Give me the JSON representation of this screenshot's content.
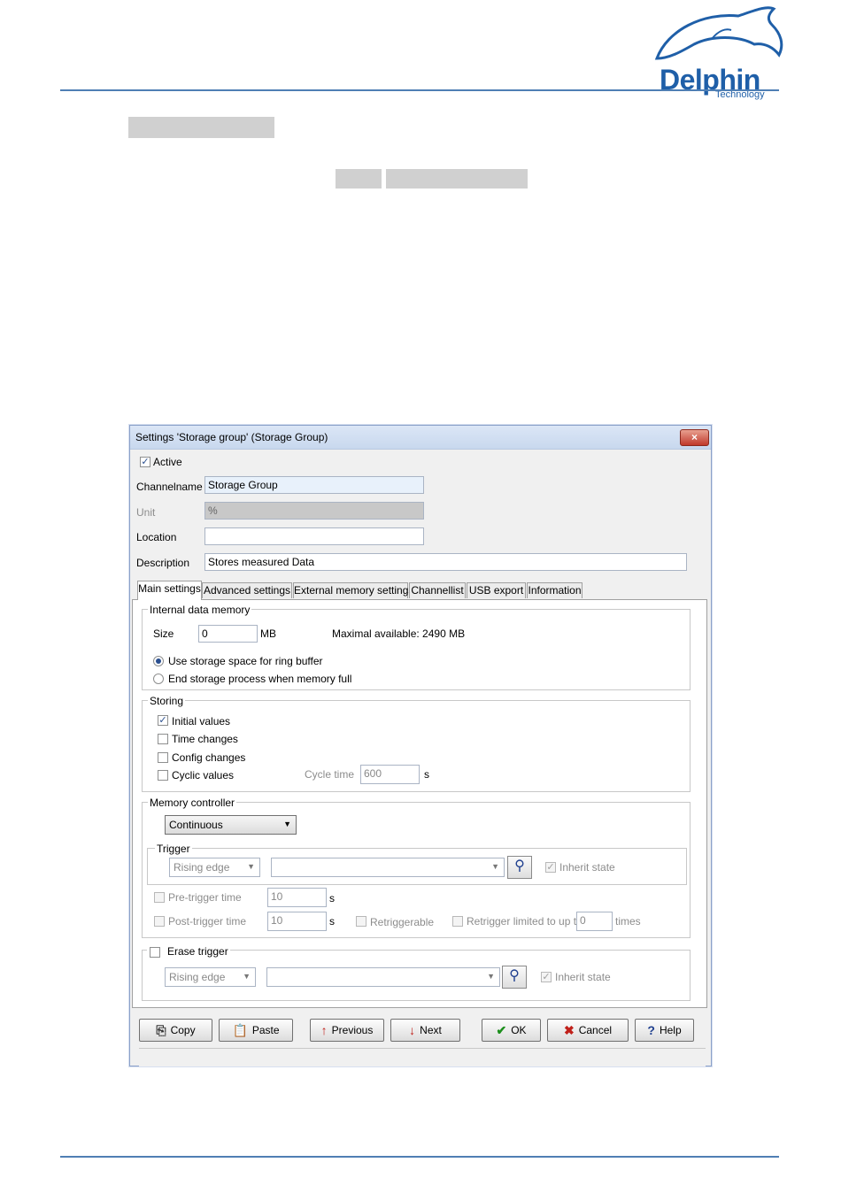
{
  "logo": {
    "name": "Delphin",
    "sub": "Technology"
  },
  "dialog": {
    "title": "Settings 'Storage group' (Storage Group)",
    "close": "×",
    "active_label": "Active",
    "active_check": "✓",
    "channelname": {
      "label": "Channelname",
      "value": "Storage Group"
    },
    "unit": {
      "label": "Unit",
      "value": "%"
    },
    "location": {
      "label": "Location",
      "value": ""
    },
    "description": {
      "label": "Description",
      "value": "Stores measured Data"
    },
    "tabs": [
      "Main settings",
      "Advanced settings",
      "External memory settings",
      "Channellist",
      "USB export",
      "Information"
    ],
    "internal_memory": {
      "title": "Internal data memory",
      "size_label": "Size",
      "size_value": "0",
      "size_unit": "MB",
      "max_available": "Maximal available: 2490 MB",
      "radio_ring": "Use storage space for ring buffer",
      "radio_end": "End storage process when memory full"
    },
    "storing": {
      "title": "Storing",
      "initial_values": "Initial values",
      "time_changes": "Time changes",
      "config_changes": "Config changes",
      "cyclic_values": "Cyclic values",
      "cycle_time_label": "Cycle time",
      "cycle_time_value": "600",
      "cycle_time_unit": "s",
      "check": "✓"
    },
    "memory_controller": {
      "title": "Memory controller",
      "mode": "Continuous",
      "trigger_title": "Trigger",
      "trigger_edge": "Rising edge",
      "trigger_channel": "",
      "inherit_state": "Inherit state",
      "pre_trigger_label": "Pre-trigger time",
      "pre_trigger_value": "10",
      "post_trigger_label": "Post-trigger time",
      "post_trigger_value": "10",
      "unit_s": "s",
      "retriggerable": "Retriggerable",
      "retrigger_limited": "Retrigger limited to up to",
      "retrigger_value": "0",
      "times": "times"
    },
    "erase_trigger": {
      "title": "Erase trigger",
      "edge": "Rising edge",
      "channel": "",
      "inherit_state": "Inherit state"
    },
    "buttons": {
      "copy": "Copy",
      "paste": "Paste",
      "previous": "Previous",
      "next": "Next",
      "ok": "OK",
      "cancel": "Cancel",
      "help": "Help"
    }
  }
}
